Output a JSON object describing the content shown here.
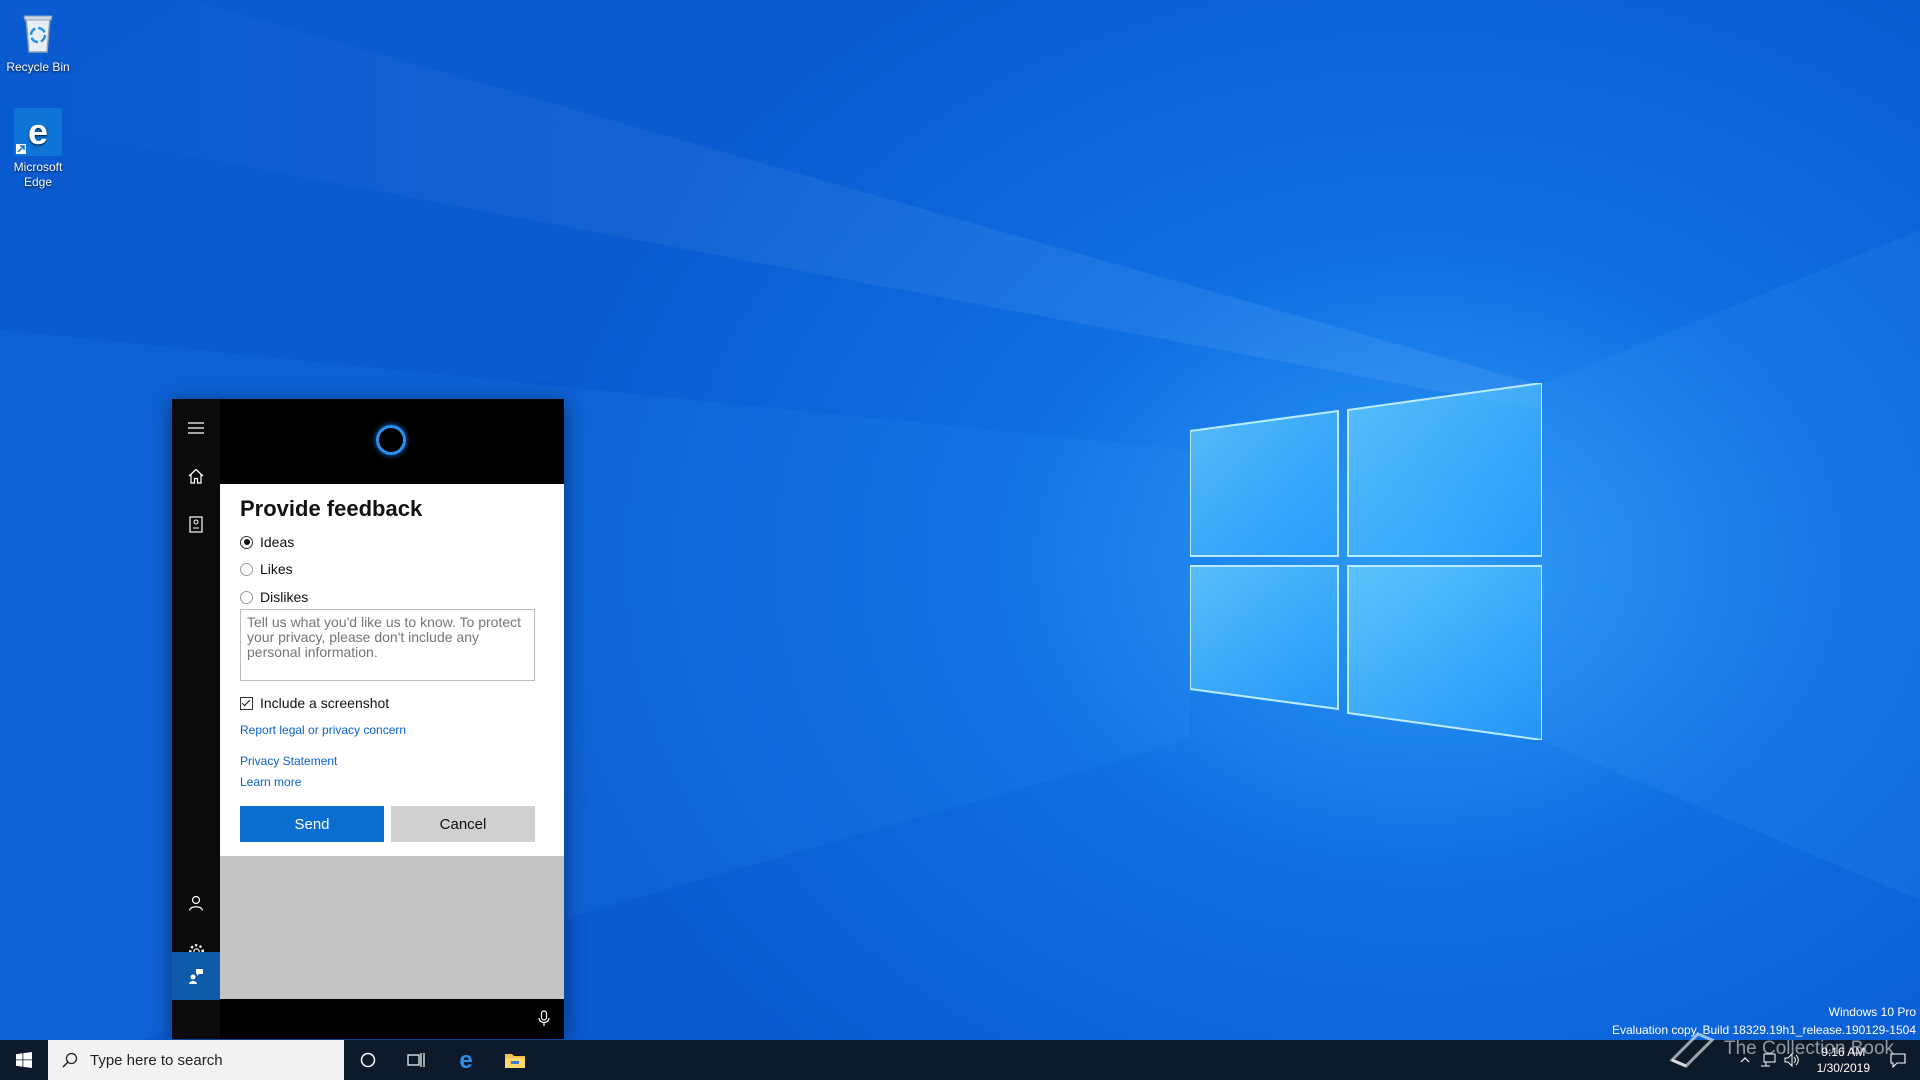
{
  "desktop": {
    "icons": [
      {
        "label": "Recycle Bin"
      },
      {
        "label": "Microsoft Edge"
      }
    ],
    "watermark": {
      "edition": "Windows 10 Pro",
      "build": "Evaluation copy. Build 18329.19h1_release.190129-1504"
    },
    "brand": "The Collection Book"
  },
  "cortana": {
    "rail_icons": [
      "hamburger-menu-icon",
      "home-icon",
      "notebook-icon",
      "person-icon",
      "settings-icon",
      "feedback-icon"
    ],
    "feedback": {
      "title": "Provide feedback",
      "options": [
        {
          "label": "Ideas",
          "selected": true
        },
        {
          "label": "Likes",
          "selected": false
        },
        {
          "label": "Dislikes",
          "selected": false
        }
      ],
      "text_placeholder": "Tell us what you'd like us to know. To protect your privacy, please don't include any personal information.",
      "include_screenshot_label": "Include a screenshot",
      "include_screenshot_checked": true,
      "links": {
        "report": "Report legal or privacy concern",
        "privacy": "Privacy Statement",
        "learn": "Learn more"
      },
      "send_label": "Send",
      "cancel_label": "Cancel"
    }
  },
  "taskbar": {
    "search_placeholder": "Type here to search",
    "time": "9:16 AM",
    "date": "1/30/2019",
    "accent": "#0a6ed1"
  }
}
